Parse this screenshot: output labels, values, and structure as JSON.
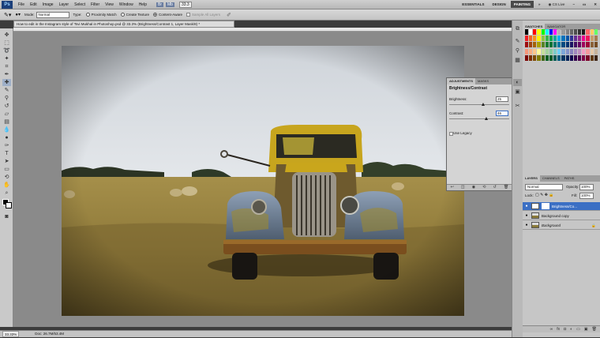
{
  "menubar": {
    "logo": "Ps",
    "items": [
      "File",
      "Edit",
      "Image",
      "Layer",
      "Select",
      "Filter",
      "View",
      "Window",
      "Help"
    ],
    "zoom_value": "33.3",
    "workspaces": [
      "ESSENTIALS",
      "DESIGN",
      "PAINTING"
    ],
    "active_workspace": "PAINTING",
    "cs_live": "CS Live"
  },
  "options": {
    "mode_label": "Mode:",
    "mode_value": "Normal",
    "type_label": "Type:",
    "types": [
      "Proximity Match",
      "Create Texture",
      "Content-Aware"
    ],
    "selected_type": "Content-Aware",
    "sample_all": "Sample All Layers"
  },
  "document": {
    "tab_title": "How to edit in the Instagram style of Tsvi Mukhal in Photoshop.psd @ 33.3% (Brightness/Contrast 1, Layer Mask/8) *",
    "zoom": "33.33%",
    "doc_size": "Doc: 26.7M/53.4M"
  },
  "swatches": {
    "tabs": [
      "SWATCHES",
      "NAVIGATOR"
    ],
    "colors": [
      "#000000",
      "#ffffff",
      "#ff0000",
      "#ffff00",
      "#00ff00",
      "#00ffff",
      "#0000ff",
      "#ff00ff",
      "#b3b3b3",
      "#999999",
      "#808080",
      "#666666",
      "#4d4d4d",
      "#333333",
      "#1a1a1a",
      "#ff6666",
      "#ffcc66",
      "#66ff66",
      "#ed1c24",
      "#f26522",
      "#f7941d",
      "#fff200",
      "#8dc63f",
      "#39b54a",
      "#00a651",
      "#00a99d",
      "#00aeef",
      "#0072bc",
      "#0054a6",
      "#2e3192",
      "#662d91",
      "#92278f",
      "#ec008c",
      "#ed145b",
      "#c69c6d",
      "#a67c52",
      "#9e0b0f",
      "#a0410d",
      "#a36209",
      "#aba000",
      "#598527",
      "#197b30",
      "#007236",
      "#00746b",
      "#0076a3",
      "#004a80",
      "#003471",
      "#1b1464",
      "#440e62",
      "#630460",
      "#9e005d",
      "#9e0039",
      "#8c6239",
      "#754c24",
      "#f69679",
      "#f9ad81",
      "#fdc68a",
      "#fff799",
      "#c4df9b",
      "#a3d39c",
      "#82ca9d",
      "#7accc8",
      "#6dcff6",
      "#7da7d9",
      "#8393ca",
      "#8781bd",
      "#a186be",
      "#bd8cbf",
      "#f49ac1",
      "#f5989d",
      "#e6c9a8",
      "#c7b299",
      "#790000",
      "#7b2e00",
      "#7d4900",
      "#827b00",
      "#406618",
      "#005e20",
      "#005826",
      "#005952",
      "#005b7f",
      "#003663",
      "#002157",
      "#0d004c",
      "#32004b",
      "#4b0049",
      "#7b0046",
      "#7a0026",
      "#603913",
      "#3c2415"
    ]
  },
  "adjustments": {
    "tabs": [
      "ADJUSTMENTS",
      "MASKS"
    ],
    "title": "Brightness/Contrast",
    "brightness_label": "Brightness:",
    "brightness_value": "25",
    "brightness_level": 0.56,
    "contrast_label": "Contrast:",
    "contrast_value": "46",
    "contrast_level": 0.62,
    "use_legacy": "Use Legacy"
  },
  "layers": {
    "tabs": [
      "LAYERS",
      "CHANNELS",
      "PATHS"
    ],
    "blend_mode": "Normal",
    "opacity_label": "Opacity:",
    "opacity_value": "100%",
    "lock_label": "Lock:",
    "fill_label": "Fill:",
    "fill_value": "100%",
    "items": [
      {
        "name": "Brightness/Co...",
        "selected": true
      },
      {
        "name": "Background copy",
        "selected": false
      },
      {
        "name": "Background",
        "selected": false
      }
    ]
  }
}
